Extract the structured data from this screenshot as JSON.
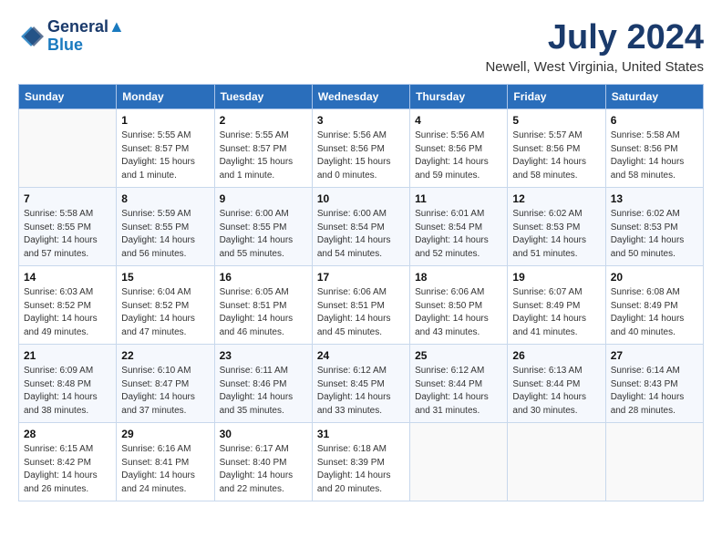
{
  "logo": {
    "line1": "General",
    "line2": "Blue"
  },
  "title": "July 2024",
  "location": "Newell, West Virginia, United States",
  "days_header": [
    "Sunday",
    "Monday",
    "Tuesday",
    "Wednesday",
    "Thursday",
    "Friday",
    "Saturday"
  ],
  "weeks": [
    [
      {
        "day": "",
        "info": ""
      },
      {
        "day": "1",
        "info": "Sunrise: 5:55 AM\nSunset: 8:57 PM\nDaylight: 15 hours\nand 1 minute."
      },
      {
        "day": "2",
        "info": "Sunrise: 5:55 AM\nSunset: 8:57 PM\nDaylight: 15 hours\nand 1 minute."
      },
      {
        "day": "3",
        "info": "Sunrise: 5:56 AM\nSunset: 8:56 PM\nDaylight: 15 hours\nand 0 minutes."
      },
      {
        "day": "4",
        "info": "Sunrise: 5:56 AM\nSunset: 8:56 PM\nDaylight: 14 hours\nand 59 minutes."
      },
      {
        "day": "5",
        "info": "Sunrise: 5:57 AM\nSunset: 8:56 PM\nDaylight: 14 hours\nand 58 minutes."
      },
      {
        "day": "6",
        "info": "Sunrise: 5:58 AM\nSunset: 8:56 PM\nDaylight: 14 hours\nand 58 minutes."
      }
    ],
    [
      {
        "day": "7",
        "info": "Sunrise: 5:58 AM\nSunset: 8:55 PM\nDaylight: 14 hours\nand 57 minutes."
      },
      {
        "day": "8",
        "info": "Sunrise: 5:59 AM\nSunset: 8:55 PM\nDaylight: 14 hours\nand 56 minutes."
      },
      {
        "day": "9",
        "info": "Sunrise: 6:00 AM\nSunset: 8:55 PM\nDaylight: 14 hours\nand 55 minutes."
      },
      {
        "day": "10",
        "info": "Sunrise: 6:00 AM\nSunset: 8:54 PM\nDaylight: 14 hours\nand 54 minutes."
      },
      {
        "day": "11",
        "info": "Sunrise: 6:01 AM\nSunset: 8:54 PM\nDaylight: 14 hours\nand 52 minutes."
      },
      {
        "day": "12",
        "info": "Sunrise: 6:02 AM\nSunset: 8:53 PM\nDaylight: 14 hours\nand 51 minutes."
      },
      {
        "day": "13",
        "info": "Sunrise: 6:02 AM\nSunset: 8:53 PM\nDaylight: 14 hours\nand 50 minutes."
      }
    ],
    [
      {
        "day": "14",
        "info": "Sunrise: 6:03 AM\nSunset: 8:52 PM\nDaylight: 14 hours\nand 49 minutes."
      },
      {
        "day": "15",
        "info": "Sunrise: 6:04 AM\nSunset: 8:52 PM\nDaylight: 14 hours\nand 47 minutes."
      },
      {
        "day": "16",
        "info": "Sunrise: 6:05 AM\nSunset: 8:51 PM\nDaylight: 14 hours\nand 46 minutes."
      },
      {
        "day": "17",
        "info": "Sunrise: 6:06 AM\nSunset: 8:51 PM\nDaylight: 14 hours\nand 45 minutes."
      },
      {
        "day": "18",
        "info": "Sunrise: 6:06 AM\nSunset: 8:50 PM\nDaylight: 14 hours\nand 43 minutes."
      },
      {
        "day": "19",
        "info": "Sunrise: 6:07 AM\nSunset: 8:49 PM\nDaylight: 14 hours\nand 41 minutes."
      },
      {
        "day": "20",
        "info": "Sunrise: 6:08 AM\nSunset: 8:49 PM\nDaylight: 14 hours\nand 40 minutes."
      }
    ],
    [
      {
        "day": "21",
        "info": "Sunrise: 6:09 AM\nSunset: 8:48 PM\nDaylight: 14 hours\nand 38 minutes."
      },
      {
        "day": "22",
        "info": "Sunrise: 6:10 AM\nSunset: 8:47 PM\nDaylight: 14 hours\nand 37 minutes."
      },
      {
        "day": "23",
        "info": "Sunrise: 6:11 AM\nSunset: 8:46 PM\nDaylight: 14 hours\nand 35 minutes."
      },
      {
        "day": "24",
        "info": "Sunrise: 6:12 AM\nSunset: 8:45 PM\nDaylight: 14 hours\nand 33 minutes."
      },
      {
        "day": "25",
        "info": "Sunrise: 6:12 AM\nSunset: 8:44 PM\nDaylight: 14 hours\nand 31 minutes."
      },
      {
        "day": "26",
        "info": "Sunrise: 6:13 AM\nSunset: 8:44 PM\nDaylight: 14 hours\nand 30 minutes."
      },
      {
        "day": "27",
        "info": "Sunrise: 6:14 AM\nSunset: 8:43 PM\nDaylight: 14 hours\nand 28 minutes."
      }
    ],
    [
      {
        "day": "28",
        "info": "Sunrise: 6:15 AM\nSunset: 8:42 PM\nDaylight: 14 hours\nand 26 minutes."
      },
      {
        "day": "29",
        "info": "Sunrise: 6:16 AM\nSunset: 8:41 PM\nDaylight: 14 hours\nand 24 minutes."
      },
      {
        "day": "30",
        "info": "Sunrise: 6:17 AM\nSunset: 8:40 PM\nDaylight: 14 hours\nand 22 minutes."
      },
      {
        "day": "31",
        "info": "Sunrise: 6:18 AM\nSunset: 8:39 PM\nDaylight: 14 hours\nand 20 minutes."
      },
      {
        "day": "",
        "info": ""
      },
      {
        "day": "",
        "info": ""
      },
      {
        "day": "",
        "info": ""
      }
    ]
  ]
}
